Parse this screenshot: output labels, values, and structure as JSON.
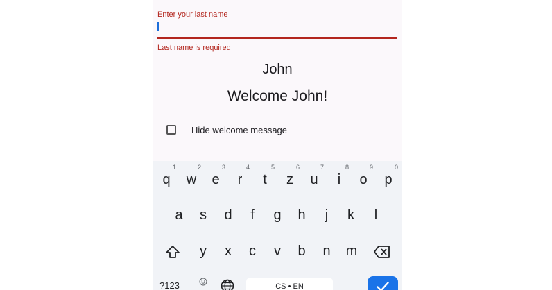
{
  "form": {
    "last_name_label": "Enter your last name",
    "last_name_value": "",
    "error_text": "Last name is required",
    "name_display": "John",
    "welcome_text": "Welcome John!",
    "hide_welcome_label": "Hide welcome message",
    "hide_welcome_checked": false
  },
  "keyboard": {
    "row1": [
      {
        "key": "q",
        "hint": "1"
      },
      {
        "key": "w",
        "hint": "2"
      },
      {
        "key": "e",
        "hint": "3"
      },
      {
        "key": "r",
        "hint": "4"
      },
      {
        "key": "t",
        "hint": "5"
      },
      {
        "key": "z",
        "hint": "6"
      },
      {
        "key": "u",
        "hint": "7"
      },
      {
        "key": "i",
        "hint": "8"
      },
      {
        "key": "o",
        "hint": "9"
      },
      {
        "key": "p",
        "hint": "0"
      }
    ],
    "row2": [
      "a",
      "s",
      "d",
      "f",
      "g",
      "h",
      "j",
      "k",
      "l"
    ],
    "row3": [
      "y",
      "x",
      "c",
      "v",
      "b",
      "n",
      "m"
    ],
    "symbols_label": "?123",
    "space_label": "CS • EN",
    "accent_color": "#1a73e8",
    "icons": [
      "shift-icon",
      "backspace-icon",
      "emoji-icon",
      "globe-icon",
      "checkmark-icon"
    ]
  }
}
